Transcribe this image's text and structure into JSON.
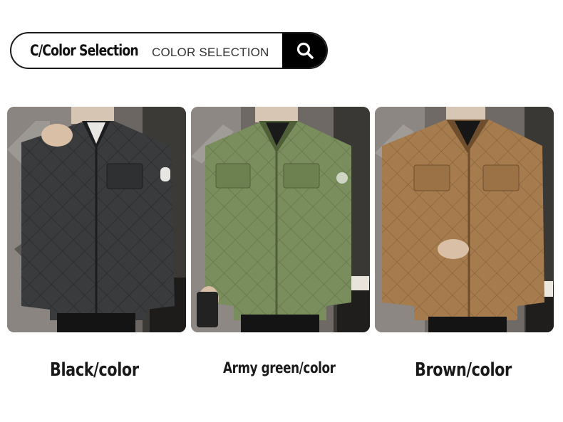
{
  "search": {
    "title": "C/Color Selection",
    "placeholder": "COLOR SELECTION",
    "icon": "search-icon"
  },
  "products": [
    {
      "label": "Black/color",
      "jacket_color": "#3a3b3d",
      "jacket_shadow": "#1c1d1f",
      "jacket_highlight": "#5a5c60"
    },
    {
      "label": "Army green/color",
      "jacket_color": "#7a8d5c",
      "jacket_shadow": "#4f5f38",
      "jacket_highlight": "#9aab7a"
    },
    {
      "label": "Brown/color",
      "jacket_color": "#a67c4e",
      "jacket_shadow": "#6e4e2c",
      "jacket_highlight": "#c49c6c"
    }
  ]
}
